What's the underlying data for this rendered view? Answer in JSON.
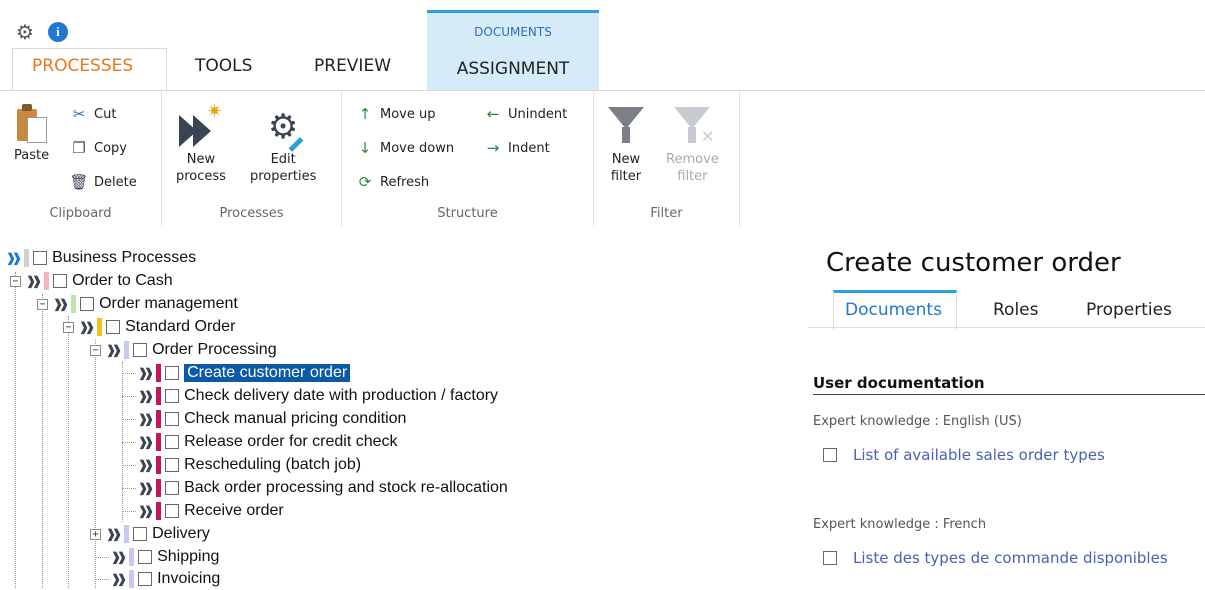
{
  "tabs": {
    "processes": "PROCESSES",
    "tools": "TOOLS",
    "preview": "PREVIEW",
    "context_group": "DOCUMENTS",
    "assignment": "ASSIGNMENT"
  },
  "ribbon": {
    "clipboard": {
      "label": "Clipboard",
      "paste": "Paste",
      "cut": "Cut",
      "copy": "Copy",
      "delete": "Delete"
    },
    "processes": {
      "label": "Processes",
      "new_line1": "New",
      "new_line2": "process",
      "edit_line1": "Edit",
      "edit_line2": "properties"
    },
    "structure": {
      "label": "Structure",
      "move_up": "Move up",
      "move_down": "Move down",
      "refresh": "Refresh",
      "unindent": "Unindent",
      "indent": "Indent"
    },
    "filter": {
      "label": "Filter",
      "new_line1": "New",
      "new_line2": "filter",
      "remove_line1": "Remove",
      "remove_line2": "filter"
    }
  },
  "tree": {
    "items": [
      {
        "label": "Business Processes",
        "color": "#cfcfcf"
      },
      {
        "label": "Order to Cash",
        "color": "#f4b7bd"
      },
      {
        "label": "Order management",
        "color": "#bfe3b5"
      },
      {
        "label": "Standard Order",
        "color": "#f2c21b"
      },
      {
        "label": "Order Processing",
        "color": "#c9c9ef"
      },
      {
        "label": "Create customer order",
        "color": "#c2185b"
      },
      {
        "label": "Check delivery date with production / factory",
        "color": "#c2185b"
      },
      {
        "label": "Check manual pricing condition",
        "color": "#c2185b"
      },
      {
        "label": "Release order for credit check",
        "color": "#c2185b"
      },
      {
        "label": "Rescheduling (batch job)",
        "color": "#c2185b"
      },
      {
        "label": "Back order processing and stock re-allocation",
        "color": "#c2185b"
      },
      {
        "label": "Receive order",
        "color": "#c2185b"
      },
      {
        "label": "Delivery",
        "color": "#c9c9ef"
      },
      {
        "label": "Shipping",
        "color": "#c9c9ef"
      },
      {
        "label": "Invoicing",
        "color": "#c9c9ef"
      }
    ]
  },
  "panel": {
    "title": "Create customer order",
    "tabs": [
      "Documents",
      "Roles",
      "Properties"
    ],
    "section": "User documentation",
    "groups": [
      {
        "heading": "Expert knowledge : English (US)",
        "doc": "List of available sales order types"
      },
      {
        "heading": "Expert knowledge : French",
        "doc": "Liste des types de commande disponibles"
      }
    ]
  },
  "colors": {
    "accent": "#e87722",
    "selection": "#0c5aa6",
    "link": "#4a5fb5",
    "tab_highlight": "#2d9fdb"
  }
}
